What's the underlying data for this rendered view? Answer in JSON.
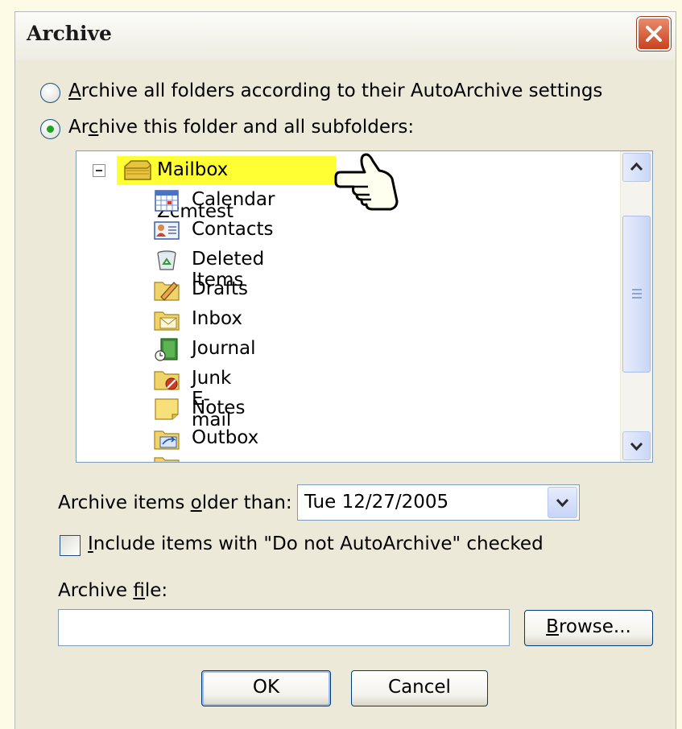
{
  "window": {
    "title": "Archive",
    "close_tooltip_icon": "close-icon"
  },
  "options": {
    "all_folders_label": "Archive all folders according to their AutoArchive settings",
    "this_folder_label": "Archive this folder and all subfolders:",
    "selected": "this_folder"
  },
  "tree": {
    "root": {
      "label": "Mailbox - Zcmtest",
      "icon": "mailbox-icon",
      "expanded": true,
      "highlighted": true
    },
    "items": [
      {
        "label": "Calendar",
        "icon": "calendar-icon"
      },
      {
        "label": "Contacts",
        "icon": "contacts-icon"
      },
      {
        "label": "Deleted Items",
        "icon": "deleted-items-icon"
      },
      {
        "label": "Drafts",
        "icon": "drafts-folder-icon"
      },
      {
        "label": "Inbox",
        "icon": "inbox-folder-icon"
      },
      {
        "label": "Journal",
        "icon": "journal-icon"
      },
      {
        "label": "Junk E-mail",
        "icon": "junk-email-folder-icon"
      },
      {
        "label": "Notes",
        "icon": "notes-icon"
      },
      {
        "label": "Outbox",
        "icon": "outbox-folder-icon"
      }
    ]
  },
  "archive_older": {
    "label": "Archive items older than:",
    "value": "Tue 12/27/2005"
  },
  "include_checkbox": {
    "label": "Include items with \"Do not AutoArchive\" checked",
    "checked": false
  },
  "archive_file": {
    "label": "Archive file:",
    "value": "",
    "browse_label": "Browse..."
  },
  "buttons": {
    "ok": "OK",
    "cancel": "Cancel"
  },
  "colors": {
    "highlight": "#ffff33",
    "dialog_bg": "#ece9d8",
    "close_red": "#c9411f"
  }
}
